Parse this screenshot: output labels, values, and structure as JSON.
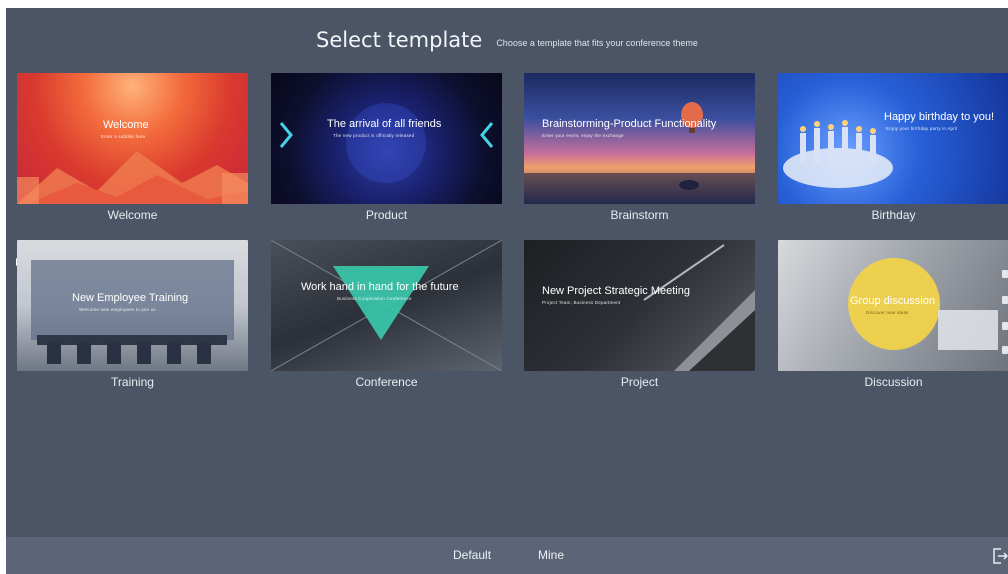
{
  "header": {
    "title": "Select template",
    "subtitle": "Choose a template that fits your conference theme"
  },
  "templates": [
    {
      "label": "Welcome",
      "line1": "Welcome",
      "line2": "Enter a subtitle here"
    },
    {
      "label": "Product",
      "line1": "The arrival of all friends",
      "line2": "The new product is officially released"
    },
    {
      "label": "Brainstorm",
      "line1": "Brainstorming-Product Functionality",
      "line2": "Enter your event, enjoy the exchange"
    },
    {
      "label": "Birthday",
      "line1": "Happy birthday to you!",
      "line2": "Enjoy your birthday party in April"
    },
    {
      "label": "Training",
      "line1": "New Employee Training",
      "line2": "Welcome new employees to join us"
    },
    {
      "label": "Conference",
      "line1": "Work hand in hand  for the future",
      "line2": "Business Cooperation Conference"
    },
    {
      "label": "Project",
      "line1": "New Project Strategic Meeting",
      "line2": "Project Team, Business Department"
    },
    {
      "label": "Discussion",
      "line1": "Group discussion",
      "line2": "Discover new ideas"
    }
  ],
  "bottom_tabs": {
    "default": "Default",
    "mine": "Mine"
  },
  "icons": {
    "exit": "exit-icon"
  }
}
